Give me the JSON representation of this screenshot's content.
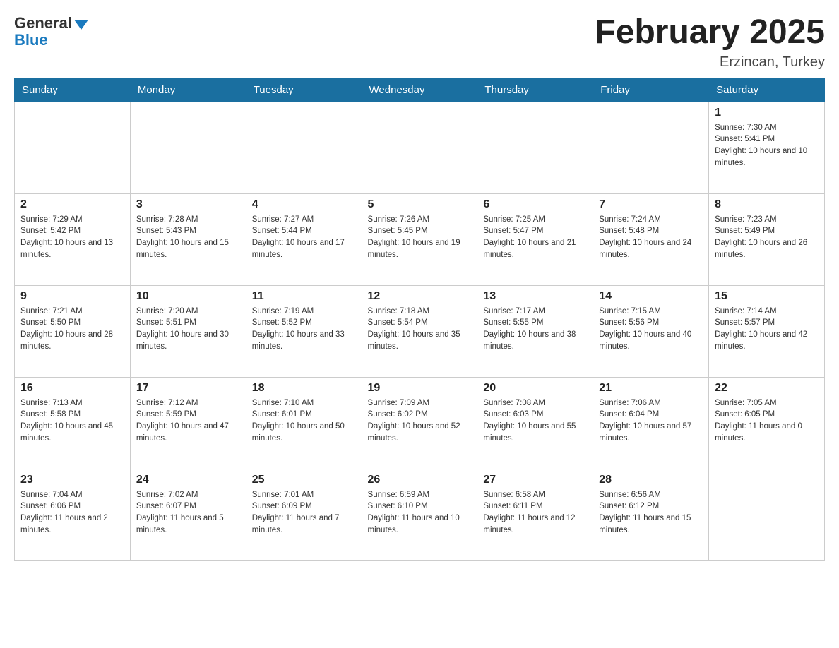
{
  "logo": {
    "general": "General",
    "blue": "Blue"
  },
  "title": "February 2025",
  "location": "Erzincan, Turkey",
  "days_of_week": [
    "Sunday",
    "Monday",
    "Tuesday",
    "Wednesday",
    "Thursday",
    "Friday",
    "Saturday"
  ],
  "weeks": [
    [
      {
        "day": "",
        "sunrise": "",
        "sunset": "",
        "daylight": ""
      },
      {
        "day": "",
        "sunrise": "",
        "sunset": "",
        "daylight": ""
      },
      {
        "day": "",
        "sunrise": "",
        "sunset": "",
        "daylight": ""
      },
      {
        "day": "",
        "sunrise": "",
        "sunset": "",
        "daylight": ""
      },
      {
        "day": "",
        "sunrise": "",
        "sunset": "",
        "daylight": ""
      },
      {
        "day": "",
        "sunrise": "",
        "sunset": "",
        "daylight": ""
      },
      {
        "day": "1",
        "sunrise": "Sunrise: 7:30 AM",
        "sunset": "Sunset: 5:41 PM",
        "daylight": "Daylight: 10 hours and 10 minutes."
      }
    ],
    [
      {
        "day": "2",
        "sunrise": "Sunrise: 7:29 AM",
        "sunset": "Sunset: 5:42 PM",
        "daylight": "Daylight: 10 hours and 13 minutes."
      },
      {
        "day": "3",
        "sunrise": "Sunrise: 7:28 AM",
        "sunset": "Sunset: 5:43 PM",
        "daylight": "Daylight: 10 hours and 15 minutes."
      },
      {
        "day": "4",
        "sunrise": "Sunrise: 7:27 AM",
        "sunset": "Sunset: 5:44 PM",
        "daylight": "Daylight: 10 hours and 17 minutes."
      },
      {
        "day": "5",
        "sunrise": "Sunrise: 7:26 AM",
        "sunset": "Sunset: 5:45 PM",
        "daylight": "Daylight: 10 hours and 19 minutes."
      },
      {
        "day": "6",
        "sunrise": "Sunrise: 7:25 AM",
        "sunset": "Sunset: 5:47 PM",
        "daylight": "Daylight: 10 hours and 21 minutes."
      },
      {
        "day": "7",
        "sunrise": "Sunrise: 7:24 AM",
        "sunset": "Sunset: 5:48 PM",
        "daylight": "Daylight: 10 hours and 24 minutes."
      },
      {
        "day": "8",
        "sunrise": "Sunrise: 7:23 AM",
        "sunset": "Sunset: 5:49 PM",
        "daylight": "Daylight: 10 hours and 26 minutes."
      }
    ],
    [
      {
        "day": "9",
        "sunrise": "Sunrise: 7:21 AM",
        "sunset": "Sunset: 5:50 PM",
        "daylight": "Daylight: 10 hours and 28 minutes."
      },
      {
        "day": "10",
        "sunrise": "Sunrise: 7:20 AM",
        "sunset": "Sunset: 5:51 PM",
        "daylight": "Daylight: 10 hours and 30 minutes."
      },
      {
        "day": "11",
        "sunrise": "Sunrise: 7:19 AM",
        "sunset": "Sunset: 5:52 PM",
        "daylight": "Daylight: 10 hours and 33 minutes."
      },
      {
        "day": "12",
        "sunrise": "Sunrise: 7:18 AM",
        "sunset": "Sunset: 5:54 PM",
        "daylight": "Daylight: 10 hours and 35 minutes."
      },
      {
        "day": "13",
        "sunrise": "Sunrise: 7:17 AM",
        "sunset": "Sunset: 5:55 PM",
        "daylight": "Daylight: 10 hours and 38 minutes."
      },
      {
        "day": "14",
        "sunrise": "Sunrise: 7:15 AM",
        "sunset": "Sunset: 5:56 PM",
        "daylight": "Daylight: 10 hours and 40 minutes."
      },
      {
        "day": "15",
        "sunrise": "Sunrise: 7:14 AM",
        "sunset": "Sunset: 5:57 PM",
        "daylight": "Daylight: 10 hours and 42 minutes."
      }
    ],
    [
      {
        "day": "16",
        "sunrise": "Sunrise: 7:13 AM",
        "sunset": "Sunset: 5:58 PM",
        "daylight": "Daylight: 10 hours and 45 minutes."
      },
      {
        "day": "17",
        "sunrise": "Sunrise: 7:12 AM",
        "sunset": "Sunset: 5:59 PM",
        "daylight": "Daylight: 10 hours and 47 minutes."
      },
      {
        "day": "18",
        "sunrise": "Sunrise: 7:10 AM",
        "sunset": "Sunset: 6:01 PM",
        "daylight": "Daylight: 10 hours and 50 minutes."
      },
      {
        "day": "19",
        "sunrise": "Sunrise: 7:09 AM",
        "sunset": "Sunset: 6:02 PM",
        "daylight": "Daylight: 10 hours and 52 minutes."
      },
      {
        "day": "20",
        "sunrise": "Sunrise: 7:08 AM",
        "sunset": "Sunset: 6:03 PM",
        "daylight": "Daylight: 10 hours and 55 minutes."
      },
      {
        "day": "21",
        "sunrise": "Sunrise: 7:06 AM",
        "sunset": "Sunset: 6:04 PM",
        "daylight": "Daylight: 10 hours and 57 minutes."
      },
      {
        "day": "22",
        "sunrise": "Sunrise: 7:05 AM",
        "sunset": "Sunset: 6:05 PM",
        "daylight": "Daylight: 11 hours and 0 minutes."
      }
    ],
    [
      {
        "day": "23",
        "sunrise": "Sunrise: 7:04 AM",
        "sunset": "Sunset: 6:06 PM",
        "daylight": "Daylight: 11 hours and 2 minutes."
      },
      {
        "day": "24",
        "sunrise": "Sunrise: 7:02 AM",
        "sunset": "Sunset: 6:07 PM",
        "daylight": "Daylight: 11 hours and 5 minutes."
      },
      {
        "day": "25",
        "sunrise": "Sunrise: 7:01 AM",
        "sunset": "Sunset: 6:09 PM",
        "daylight": "Daylight: 11 hours and 7 minutes."
      },
      {
        "day": "26",
        "sunrise": "Sunrise: 6:59 AM",
        "sunset": "Sunset: 6:10 PM",
        "daylight": "Daylight: 11 hours and 10 minutes."
      },
      {
        "day": "27",
        "sunrise": "Sunrise: 6:58 AM",
        "sunset": "Sunset: 6:11 PM",
        "daylight": "Daylight: 11 hours and 12 minutes."
      },
      {
        "day": "28",
        "sunrise": "Sunrise: 6:56 AM",
        "sunset": "Sunset: 6:12 PM",
        "daylight": "Daylight: 11 hours and 15 minutes."
      },
      {
        "day": "",
        "sunrise": "",
        "sunset": "",
        "daylight": ""
      }
    ]
  ]
}
